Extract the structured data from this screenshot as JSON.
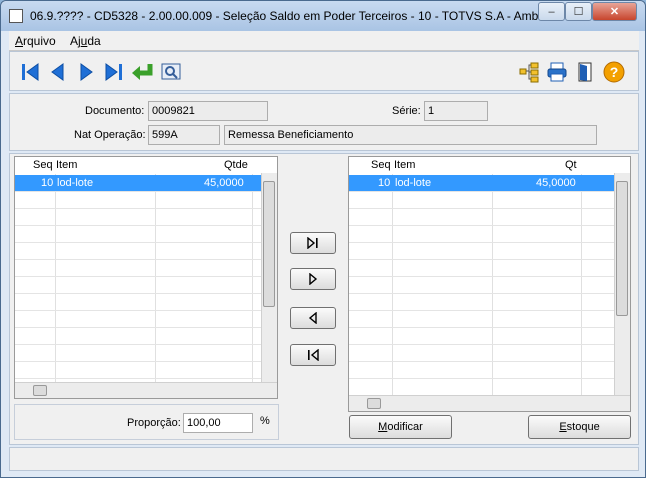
{
  "window": {
    "title": "06.9.???? - CD5328 - 2.00.00.009 - Seleção Saldo em Poder Terceiros - 10 - TOTVS S.A - Ambi...",
    "minimize": "–",
    "maximize": "☐",
    "close": "✕"
  },
  "menu": {
    "arquivo_first": "A",
    "arquivo_rest": "rquivo",
    "ajuda_first": "Aj",
    "ajuda_u": "u",
    "ajuda_rest": "da"
  },
  "header": {
    "documento_label": "Documento:",
    "documento_value": "0009821",
    "serie_label": "Série:",
    "serie_value": "1",
    "natop_label": "Nat Operação:",
    "natop_code": "599A",
    "natop_desc": "Remessa Beneficiamento"
  },
  "left_grid": {
    "columns": [
      "Seq",
      "Item",
      "Qtde"
    ],
    "rows": [
      {
        "seq": "10",
        "item": "lod-lote",
        "qty": "45,0000"
      }
    ]
  },
  "right_grid": {
    "columns": [
      "Seq",
      "Item",
      "Qt"
    ],
    "rows": [
      {
        "seq": "10",
        "item": "lod-lote",
        "qty": "45,0000"
      }
    ]
  },
  "proporcao": {
    "label": "Proporção:",
    "value": "100,00",
    "unit": "%"
  },
  "buttons": {
    "modificar_u": "M",
    "modificar_rest": "odificar",
    "estoque_u": "E",
    "estoque_rest": "stoque"
  },
  "colors": {
    "nav_blue": "#1f6fd6",
    "selection": "#3399ff",
    "help_orange": "#f3a000"
  }
}
